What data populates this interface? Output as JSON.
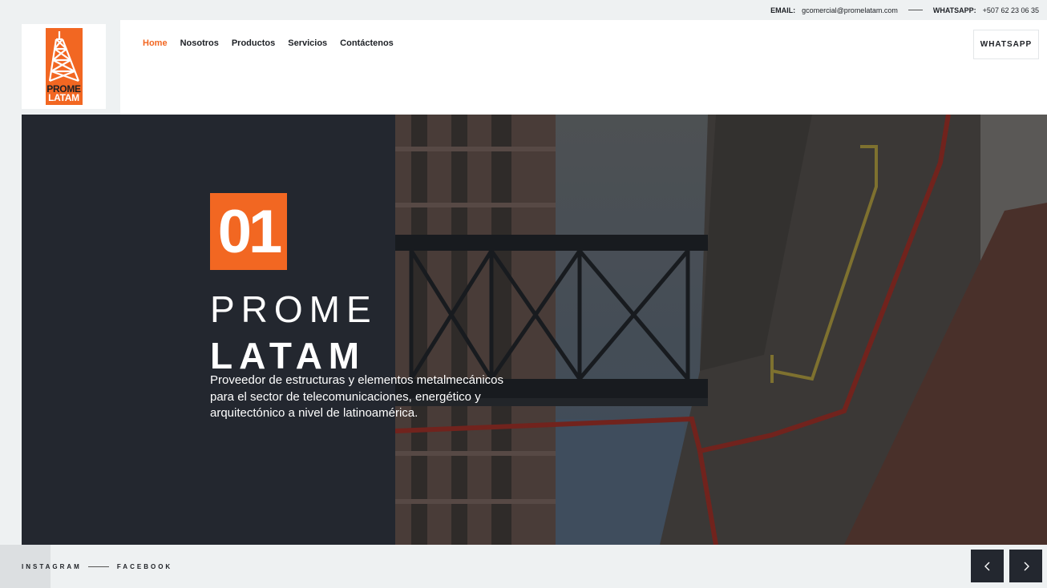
{
  "topbar": {
    "email_label": "EMAIL:",
    "email_value": "gcomercial@promelatam.com",
    "whatsapp_label": "WHATSAPP:",
    "whatsapp_value": "+507 62 23 06 35"
  },
  "logo": {
    "line1": "PROME",
    "line2": "LATAM"
  },
  "nav": {
    "items": [
      {
        "label": "Home",
        "active": true
      },
      {
        "label": "Nosotros"
      },
      {
        "label": "Productos"
      },
      {
        "label": "Servicios"
      },
      {
        "label": "Contáctenos"
      }
    ],
    "whatsapp_button": "WHATSAPP"
  },
  "hero": {
    "slide_number": "01",
    "title_line1": "PROME",
    "title_line2": "LATAM",
    "description": "Proveedor de estructuras y elementos metalmecánicos para el sector de telecomunicaciones, energético y arquitectónico a nivel de latinoamérica."
  },
  "footer": {
    "social": [
      "INSTAGRAM",
      "FACEBOOK"
    ],
    "prev_icon": "chevron-left-icon",
    "next_icon": "chevron-right-icon"
  },
  "colors": {
    "accent": "#f26722",
    "dark": "#23272f",
    "background": "#eef1f2"
  }
}
